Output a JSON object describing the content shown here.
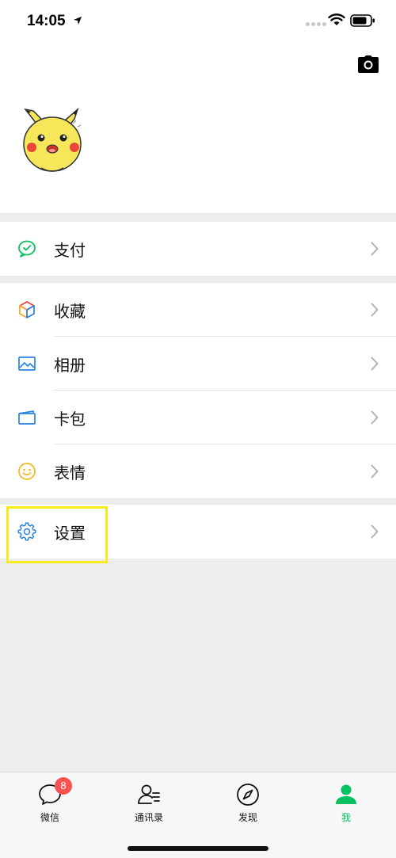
{
  "status_bar": {
    "time": "14:05"
  },
  "menu_groups": [
    {
      "items": [
        {
          "id": "pay",
          "label": "支付",
          "icon": "wechat-pay-icon"
        }
      ]
    },
    {
      "items": [
        {
          "id": "favorites",
          "label": "收藏",
          "icon": "cube-icon"
        },
        {
          "id": "album",
          "label": "相册",
          "icon": "picture-icon"
        },
        {
          "id": "cards",
          "label": "卡包",
          "icon": "card-wallet-icon"
        },
        {
          "id": "stickers",
          "label": "表情",
          "icon": "smiley-icon"
        }
      ]
    },
    {
      "items": [
        {
          "id": "settings",
          "label": "设置",
          "icon": "gear-icon"
        }
      ]
    }
  ],
  "tabbar": {
    "tabs": [
      {
        "label": "微信",
        "icon": "chat-bubble-icon",
        "badge": "8"
      },
      {
        "label": "通讯录",
        "icon": "contacts-icon"
      },
      {
        "label": "发现",
        "icon": "compass-icon"
      },
      {
        "label": "我",
        "icon": "person-icon",
        "active": true
      }
    ]
  },
  "colors": {
    "accent": "#07c160",
    "badge": "#fa5151",
    "highlight": "#f5ec1a",
    "background": "#ededed"
  }
}
